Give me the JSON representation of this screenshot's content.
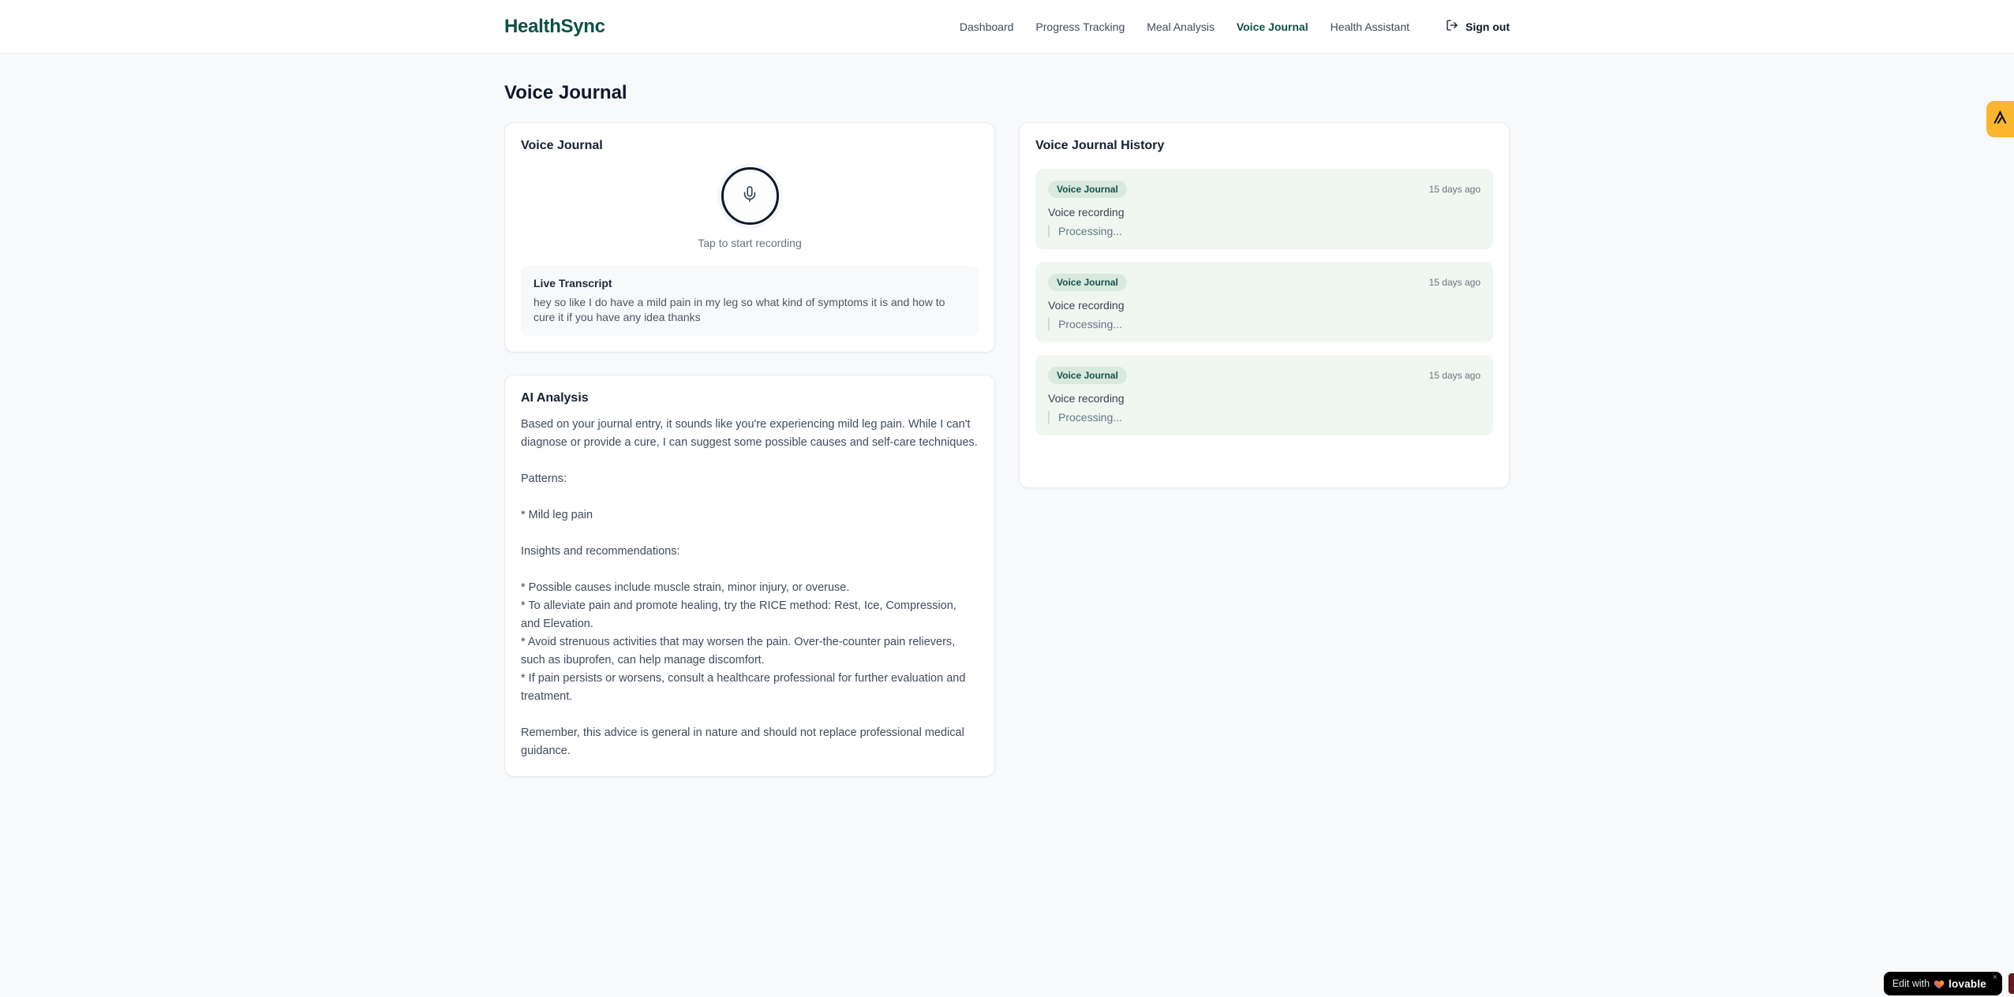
{
  "brand": "HealthSync",
  "nav": {
    "items": [
      "Dashboard",
      "Progress Tracking",
      "Meal Analysis",
      "Voice Journal",
      "Health Assistant"
    ],
    "active": "Voice Journal",
    "sign_out": "Sign out"
  },
  "page": {
    "title": "Voice Journal"
  },
  "recorder": {
    "card_title": "Voice Journal",
    "tap_hint": "Tap to start recording",
    "live_transcript_label": "Live Transcript",
    "transcript": "hey so like I do have a mild pain in my leg so what kind of symptoms it is and how to cure it if you have any idea thanks"
  },
  "ai_analysis": {
    "card_title": "AI Analysis",
    "body": "Based on your journal entry, it sounds like you're experiencing mild leg pain. While I can't diagnose or provide a cure, I can suggest some possible causes and self-care techniques.\n\nPatterns:\n\n* Mild leg pain\n\nInsights and recommendations:\n\n* Possible causes include muscle strain, minor injury, or overuse.\n* To alleviate pain and promote healing, try the RICE method: Rest, Ice, Compression, and Elevation.\n* Avoid strenuous activities that may worsen the pain. Over-the-counter pain relievers, such as ibuprofen, can help manage discomfort.\n* If pain persists or worsens, consult a healthcare professional for further evaluation and treatment.\n\nRemember, this advice is general in nature and should not replace professional medical guidance."
  },
  "history": {
    "card_title": "Voice Journal History",
    "entries": [
      {
        "badge": "Voice Journal",
        "time": "15 days ago",
        "title": "Voice recording",
        "status": "Processing..."
      },
      {
        "badge": "Voice Journal",
        "time": "15 days ago",
        "title": "Voice recording",
        "status": "Processing..."
      },
      {
        "badge": "Voice Journal",
        "time": "15 days ago",
        "title": "Voice recording",
        "status": "Processing..."
      }
    ]
  },
  "widgets": {
    "lovable": {
      "prefix": "Edit with",
      "brand": "lovable",
      "close": "×"
    }
  },
  "colors": {
    "brand_teal": "#0d5047",
    "page_bg": "#f7f9fb",
    "entry_bg": "#eff7f0",
    "badge_bg": "#d9e9de",
    "badge_text": "#14524a",
    "side_widget_amber": "#f9b62e",
    "lovable_bg": "#000000"
  }
}
